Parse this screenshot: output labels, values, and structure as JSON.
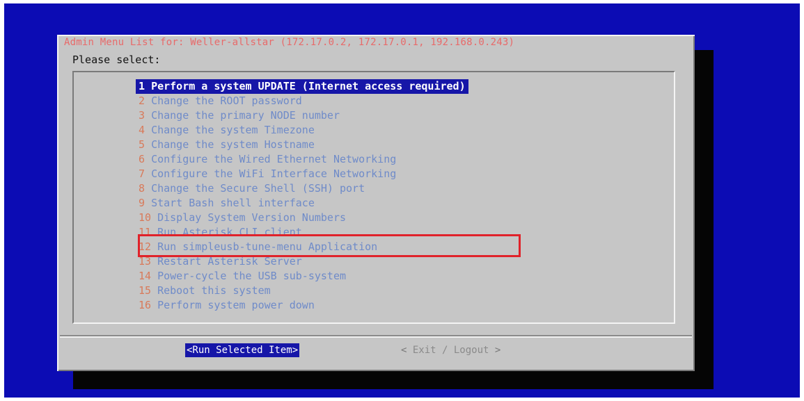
{
  "window": {
    "title": "Admin Menu List for: Weller-allstar (172.17.0.2, 172.17.0.1, 192.168.0.243)",
    "prompt": "Please select:"
  },
  "menu": {
    "items": [
      {
        "tag": "1",
        "label": "Perform a system UPDATE (Internet access required)",
        "selected": true
      },
      {
        "tag": "2",
        "label": "Change the ROOT password"
      },
      {
        "tag": "3",
        "label": "Change the primary NODE number"
      },
      {
        "tag": "4",
        "label": "Change the system Timezone"
      },
      {
        "tag": "5",
        "label": "Change the system Hostname"
      },
      {
        "tag": "6",
        "label": "Configure the Wired Ethernet Networking"
      },
      {
        "tag": "7",
        "label": "Configure the WiFi Interface Networking"
      },
      {
        "tag": "8",
        "label": "Change the Secure Shell (SSH) port"
      },
      {
        "tag": "9",
        "label": "Start Bash shell interface"
      },
      {
        "tag": "10",
        "label": "Display System Version Numbers"
      },
      {
        "tag": "11",
        "label": "Run Asterisk CLI client"
      },
      {
        "tag": "12",
        "label": "Run simpleusb-tune-menu Application"
      },
      {
        "tag": "13",
        "label": "Restart Asterisk Server"
      },
      {
        "tag": "14",
        "label": "Power-cycle the USB sub-system"
      },
      {
        "tag": "15",
        "label": "Reboot this system"
      },
      {
        "tag": "16",
        "label": "Perform system power down"
      }
    ]
  },
  "buttons": {
    "run_label": "<Run Selected Item>",
    "exit_open": "<",
    "exit_label": "Exit / Logout",
    "exit_close": ">"
  },
  "colors": {
    "screen": "#0c0cb4",
    "dialog": "#c6c6c6",
    "selected": "#1616a8",
    "highlight": "#e0222a"
  }
}
